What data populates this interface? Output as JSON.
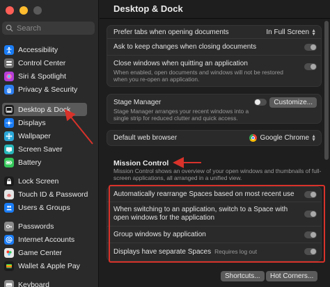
{
  "window": {
    "title": "Desktop & Dock"
  },
  "search": {
    "placeholder": "Search"
  },
  "colors": {
    "accent_red": "#d8322a",
    "selected_bg": "#5a5a5a"
  },
  "sidebar": {
    "items": [
      {
        "label": "Accessibility",
        "icon": "accessibility-icon",
        "color": "#1a7cf5"
      },
      {
        "label": "Control Center",
        "icon": "control-center-icon",
        "color": "#6b6b6b"
      },
      {
        "label": "Siri & Spotlight",
        "icon": "siri-icon",
        "color": "#b33fd9"
      },
      {
        "label": "Privacy & Security",
        "icon": "hand-icon",
        "color": "#2d7ff0"
      },
      {
        "label": "Desktop & Dock",
        "icon": "dock-icon",
        "color": "#1c1c1c"
      },
      {
        "label": "Displays",
        "icon": "sun-icon",
        "color": "#1a7cf5"
      },
      {
        "label": "Wallpaper",
        "icon": "flower-icon",
        "color": "#2aa7d8"
      },
      {
        "label": "Screen Saver",
        "icon": "screen-saver-icon",
        "color": "#28b5b9"
      },
      {
        "label": "Battery",
        "icon": "battery-icon",
        "color": "#34c759"
      },
      {
        "label": "Lock Screen",
        "icon": "lock-screen-icon",
        "color": "#1c1c1c"
      },
      {
        "label": "Touch ID & Password",
        "icon": "fingerprint-icon",
        "color": "#e5e5e5"
      },
      {
        "label": "Users & Groups",
        "icon": "users-icon",
        "color": "#1a7cf5"
      },
      {
        "label": "Passwords",
        "icon": "key-icon",
        "color": "#8a8a8a"
      },
      {
        "label": "Internet Accounts",
        "icon": "at-icon",
        "color": "#1a7cf5"
      },
      {
        "label": "Game Center",
        "icon": "game-center-icon",
        "color": "#e8e8e8"
      },
      {
        "label": "Wallet & Apple Pay",
        "icon": "wallet-icon",
        "color": "#1c1c1c"
      },
      {
        "label": "Keyboard",
        "icon": "keyboard-icon",
        "color": "#8a8a8a"
      }
    ]
  },
  "main": {
    "rows": {
      "prefer_tabs": {
        "label": "Prefer tabs when opening documents",
        "value": "In Full Screen"
      },
      "ask_keep": {
        "label": "Ask to keep changes when closing documents"
      },
      "close_windows": {
        "label": "Close windows when quitting an application",
        "desc": "When enabled, open documents and windows will not be restored when you re-open an application."
      },
      "stage_manager": {
        "label": "Stage Manager",
        "desc": "Stage Manager arranges your recent windows into a single strip for reduced clutter and quick access.",
        "button": "Customize..."
      },
      "default_browser": {
        "label": "Default web browser",
        "value": "Google Chrome"
      }
    },
    "mission_control": {
      "title": "Mission Control",
      "desc": "Mission Control shows an overview of your open windows and thumbnails of full-screen applications, all arranged in a unified view.",
      "rows": {
        "auto_rearrange": {
          "label": "Automatically rearrange Spaces based on most recent use"
        },
        "switch_space": {
          "label": "When switching to an application, switch to a Space with open windows for the application"
        },
        "group_windows": {
          "label": "Group windows by application"
        },
        "separate_spaces": {
          "label": "Displays have separate Spaces",
          "note": "Requires log out"
        }
      }
    },
    "buttons": {
      "shortcuts": "Shortcuts...",
      "hot_corners": "Hot Corners..."
    }
  }
}
